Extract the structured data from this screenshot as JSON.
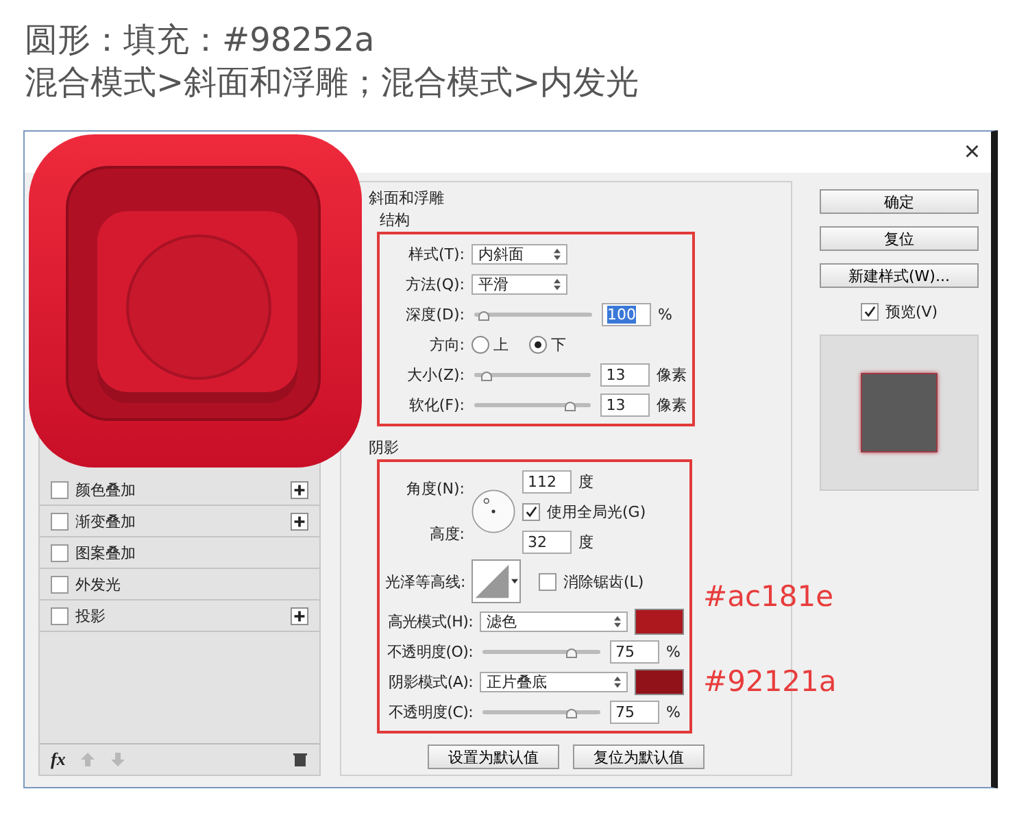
{
  "header": {
    "lines": [
      "圆形：填充：#98252a",
      "混合模式>斜面和浮雕；混合模式>内发光"
    ]
  },
  "dialog": {
    "close": "×",
    "style_list": [
      {
        "label": "颜色叠加",
        "checked": false,
        "addable": true
      },
      {
        "label": "渐变叠加",
        "checked": false,
        "addable": true
      },
      {
        "label": "图案叠加",
        "checked": false,
        "addable": false
      },
      {
        "label": "外发光",
        "checked": false,
        "addable": false
      },
      {
        "label": "投影",
        "checked": false,
        "addable": true
      }
    ],
    "fx": "fx",
    "bevel": {
      "title": "斜面和浮雕",
      "structure_title": "结构",
      "style": {
        "label": "样式(T):",
        "value": "内斜面"
      },
      "technique": {
        "label": "方法(Q):",
        "value": "平滑"
      },
      "depth": {
        "label": "深度(D):",
        "level": 0.08,
        "value": "100",
        "unit": "%",
        "highlighted": true
      },
      "direction": {
        "label": "方向:",
        "options": [
          {
            "label": "上",
            "selected": false
          },
          {
            "label": "下",
            "selected": true
          }
        ]
      },
      "size": {
        "label": "大小(Z):",
        "level": 0.1,
        "value": "13",
        "unit": "像素",
        "highlighted": false
      },
      "soften": {
        "label": "软化(F):",
        "level": 0.82,
        "value": "13",
        "unit": "像素",
        "highlighted": false
      }
    },
    "shading": {
      "title": "阴影",
      "angle": {
        "label": "角度(N):",
        "value": "112",
        "unit": "度"
      },
      "global_light": {
        "label": "使用全局光(G)",
        "checked": true
      },
      "altitude": {
        "label": "高度:",
        "value": "32",
        "unit": "度"
      },
      "gloss_contour": {
        "label": "光泽等高线:"
      },
      "anti_alias": {
        "label": "消除锯齿(L)",
        "checked": false
      },
      "modes": [
        {
          "label": "高光模式(H):",
          "value": "滤色",
          "color": "#ac181e",
          "opacity_label": "不透明度(O):",
          "level": 0.75,
          "opacity": "75",
          "unit": "%",
          "annotation": "#ac181e"
        },
        {
          "label": "阴影模式(A):",
          "value": "正片叠底",
          "color": "#92121a",
          "opacity_label": "不透明度(C):",
          "level": 0.75,
          "opacity": "75",
          "unit": "%",
          "annotation": "#92121a"
        }
      ]
    },
    "bottom_buttons": [
      "设置为默认值",
      "复位为默认值"
    ],
    "side_buttons": [
      "确定",
      "复位",
      "新建样式(W)..."
    ],
    "preview": {
      "label": "预览(V)",
      "checked": true
    }
  }
}
